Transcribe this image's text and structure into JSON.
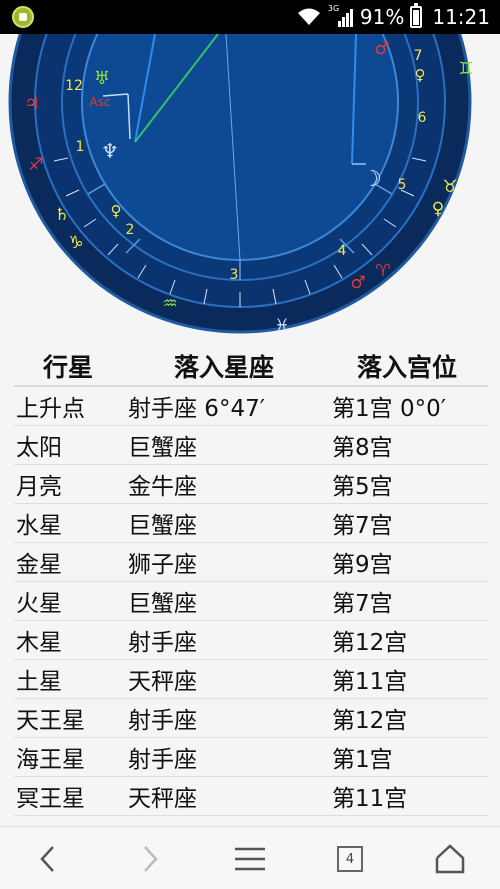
{
  "status_bar": {
    "network": "3G",
    "battery": "91%",
    "battery_level": 0.91,
    "time": "11:21"
  },
  "chart": {
    "house_numbers": [
      "12",
      "1",
      "2",
      "3",
      "4",
      "5",
      "6",
      "7"
    ],
    "sign_glyphs": [
      "♃",
      "♐",
      "♄",
      "♑",
      "♒",
      "♓",
      "♈",
      "♉",
      "♊",
      "♀",
      "♂"
    ],
    "planet_glyphs": [
      "♆",
      "☽",
      "♅",
      "♀",
      "Asc",
      "♂",
      "♀"
    ],
    "colors": {
      "ring": "#0a2a5c",
      "ring_edge": "#1f5aa0",
      "inner": "#0d4a93",
      "tick": "#cfe6ff",
      "red": "#e03a3a",
      "green": "#8fe03a",
      "yellow": "#f1e64b",
      "line_blue": "#2d8cf0",
      "line_green": "#35c06a"
    }
  },
  "table": {
    "headers": [
      "行星",
      "落入星座",
      "落入宫位"
    ],
    "rows": [
      [
        "上升点",
        "射手座 6°47′",
        "第1宫 0°0′"
      ],
      [
        "太阳",
        "巨蟹座",
        "第8宫"
      ],
      [
        "月亮",
        "金牛座",
        "第5宫"
      ],
      [
        "水星",
        "巨蟹座",
        "第7宫"
      ],
      [
        "金星",
        "狮子座",
        "第9宫"
      ],
      [
        "火星",
        "巨蟹座",
        "第7宫"
      ],
      [
        "木星",
        "射手座",
        "第12宫"
      ],
      [
        "土星",
        "天秤座",
        "第11宫"
      ],
      [
        "天王星",
        "射手座",
        "第12宫"
      ],
      [
        "海王星",
        "射手座",
        "第1宫"
      ],
      [
        "冥王星",
        "天秤座",
        "第11宫"
      ]
    ]
  },
  "nav": {
    "tab_count": "4"
  }
}
